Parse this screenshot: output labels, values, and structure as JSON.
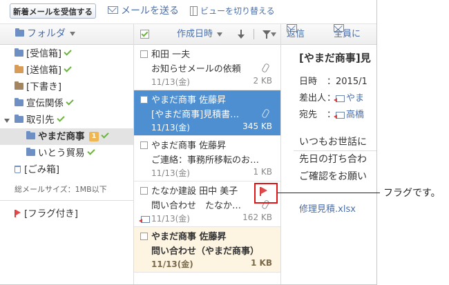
{
  "toolbar": {
    "receive_label": "新着メールを受信する",
    "send_label": "メールを送る",
    "view_label": "ビューを切り替える"
  },
  "folders": {
    "header": "フォルダ",
    "items": [
      {
        "label": "[受信箱]"
      },
      {
        "label": "[送信箱]"
      },
      {
        "label": "[下書き]"
      },
      {
        "label": "宣伝関係"
      },
      {
        "label": "取引先"
      },
      {
        "label": "やまだ商事",
        "badge": "1"
      },
      {
        "label": "いとう貿易"
      },
      {
        "label": "[ごみ箱]"
      }
    ],
    "size_info": "総メールサイズ：1MB以下",
    "flagged": "[フラグ付き]"
  },
  "mail_list": {
    "sort_label": "作成日時",
    "rows": [
      {
        "from": "和田 一夫",
        "subject": "お知らせメールの依頼",
        "date": "11/13(金)",
        "size": "2 KB"
      },
      {
        "from": "やまだ商事 佐藤昇",
        "subject": "[やまだ商事]見積書…",
        "date": "11/13(金)",
        "size": "345 KB"
      },
      {
        "from": "やまだ商事 佐藤昇",
        "subject": "ご連絡：事務所移転のお…",
        "date": "11/13(金)",
        "size": "1 KB"
      },
      {
        "from": "たなか建設 田中 美子",
        "subject": "問い合わせ　たなか…",
        "date": "11/13(金)",
        "size": "162 KB"
      },
      {
        "from": "やまだ商事 佐藤昇",
        "subject": "問い合わせ（やまだ商事）",
        "date": "11/13(金)",
        "size": "1 KB"
      }
    ]
  },
  "reader": {
    "reply_label": "返信",
    "reply_all_label": "全員に",
    "title": "[やまだ商事]見",
    "date_key": "日時",
    "date_val": "：2015/1",
    "from_key": "差出人",
    "from_val": "やま",
    "to_key": "宛先",
    "to_val": "高橋",
    "body1": "いつもお世話に",
    "body2": "先日の打ち合わ",
    "body3": "ご確認をお願い",
    "attachment": "修理見積.xlsx"
  },
  "callout": {
    "text": "フラグです。"
  }
}
